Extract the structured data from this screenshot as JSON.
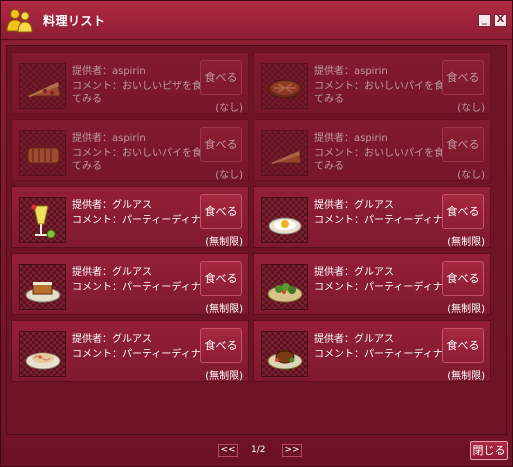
{
  "window": {
    "title": "料理リスト",
    "minimize_label": "_",
    "close_label": "X"
  },
  "dishes": [
    {
      "provider": "提供者：aspirin",
      "comment1": "コメント：おいしいピザを食べ",
      "comment2": "てみる",
      "eat_label": "食べる",
      "limit": "(なし)",
      "enabled": false,
      "icon": "pizza-slice-icon"
    },
    {
      "provider": "提供者：aspirin",
      "comment1": "コメント：おいしいパイを食べ",
      "comment2": "てみる",
      "eat_label": "食べる",
      "limit": "(なし)",
      "enabled": false,
      "icon": "pie-icon"
    },
    {
      "provider": "提供者：aspirin",
      "comment1": "コメント：おいしいパイを食べ",
      "comment2": "てみる",
      "eat_label": "食べる",
      "limit": "(なし)",
      "enabled": false,
      "icon": "bread-icon"
    },
    {
      "provider": "提供者：aspirin",
      "comment1": "コメント：おいしいパイを食べ",
      "comment2": "てみる",
      "eat_label": "食べる",
      "limit": "(なし)",
      "enabled": false,
      "icon": "pie-slice-icon"
    },
    {
      "provider": "提供者：グルアス",
      "comment1": "コメント：パーティーディナー",
      "comment2": "",
      "eat_label": "食べる",
      "limit": "(無制限)",
      "enabled": true,
      "icon": "cocktail-icon"
    },
    {
      "provider": "提供者：グルアス",
      "comment1": "コメント：パーティーディナー",
      "comment2": "",
      "eat_label": "食べる",
      "limit": "(無制限)",
      "enabled": true,
      "icon": "fried-egg-icon"
    },
    {
      "provider": "提供者：グルアス",
      "comment1": "コメント：パーティーディナー",
      "comment2": "",
      "eat_label": "食べる",
      "limit": "(無制限)",
      "enabled": true,
      "icon": "cake-plate-icon"
    },
    {
      "provider": "提供者：グルアス",
      "comment1": "コメント：パーティーディナー",
      "comment2": "",
      "eat_label": "食べる",
      "limit": "(無制限)",
      "enabled": true,
      "icon": "salad-plate-icon"
    },
    {
      "provider": "提供者：グルアス",
      "comment1": "コメント：パーティーディナー",
      "comment2": "",
      "eat_label": "食べる",
      "limit": "(無制限)",
      "enabled": true,
      "icon": "pasta-plate-icon"
    },
    {
      "provider": "提供者：グルアス",
      "comment1": "コメント：パーティーディナー",
      "comment2": "",
      "eat_label": "食べる",
      "limit": "(無制限)",
      "enabled": true,
      "icon": "meat-plate-icon"
    }
  ],
  "pager": {
    "prev_label": "<<",
    "page_text": "1/2",
    "next_label": ">>"
  },
  "footer": {
    "close_label": "閉じる"
  },
  "colors": {
    "window_bg": "#7a1729",
    "titlebar": "#b02a45",
    "text": "#ffffff"
  }
}
